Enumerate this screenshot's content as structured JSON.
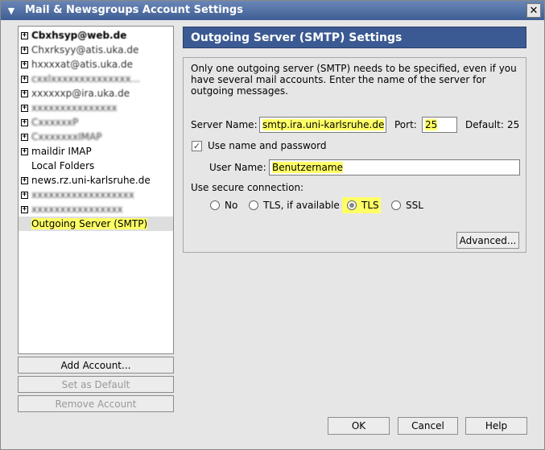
{
  "window": {
    "title": "Mail & Newsgroups Account Settings",
    "menu_glyph": "⌵",
    "close_glyph": "✕"
  },
  "tree": {
    "items": [
      {
        "label": "Cbxhsyp@web.de",
        "expander": "+",
        "blurred": true,
        "bold": true
      },
      {
        "label": "Chxrksyy@atis.uka.de",
        "expander": "+",
        "blurred": true
      },
      {
        "label": "hxxxxat@atis.uka.de",
        "expander": "+",
        "blurred": true
      },
      {
        "label": "cxxlxxxxxxxxxxxxxx...",
        "expander": "+",
        "blurred": true
      },
      {
        "label": "xxxxxxp@ira.uka.de",
        "expander": "+",
        "blurred": true
      },
      {
        "label": "xxxxxxxxxxxxxxx",
        "expander": "+",
        "blurred": true
      },
      {
        "label": "CxxxxxxP",
        "expander": "+",
        "blurred": true
      },
      {
        "label": "CxxxxxxxIMAP",
        "expander": "+",
        "blurred": true
      },
      {
        "label": "maildir IMAP",
        "expander": "+",
        "blurred": false
      },
      {
        "label": "Local Folders",
        "expander": "",
        "blurred": false
      },
      {
        "label": "news.rz.uni-karlsruhe.de",
        "expander": "+",
        "blurred": false
      },
      {
        "label": "xxxxxxxxxxxxxxxxxx",
        "expander": "+",
        "blurred": true
      },
      {
        "label": "xxxxxxxxxxxxxxxx",
        "expander": "+",
        "blurred": true
      },
      {
        "label": "Outgoing Server (SMTP)",
        "expander": "",
        "blurred": false,
        "selected": true
      }
    ]
  },
  "left_buttons": {
    "add_account": "Add Account...",
    "set_default": "Set as Default",
    "remove_account": "Remove Account"
  },
  "panel": {
    "header": "Outgoing Server (SMTP) Settings",
    "description": "Only one outgoing server (SMTP) needs to be specified, even if you have several mail accounts. Enter the name of the server for outgoing messages.",
    "server_name_label": "Server Name:",
    "server_name_value": "smtp.ira.uni-karlsruhe.de",
    "port_label": "Port:",
    "port_value": "25",
    "default_label": "Default:",
    "default_value": "25",
    "use_name_label": "Use name and password",
    "use_name_checked": true,
    "user_name_label": "User Name:",
    "user_name_value": "Benutzername",
    "secure_label": "Use secure connection:",
    "radio_no": "No",
    "radio_tls_avail": "TLS, if available",
    "radio_tls": "TLS",
    "radio_ssl": "SSL",
    "selected_security": "TLS",
    "advanced_button": "Advanced..."
  },
  "footer": {
    "ok": "OK",
    "cancel": "Cancel",
    "help": "Help"
  },
  "colors": {
    "title_bar": "#3e5e94",
    "panel_header": "#3b5a93",
    "highlight": "#ffff66"
  }
}
